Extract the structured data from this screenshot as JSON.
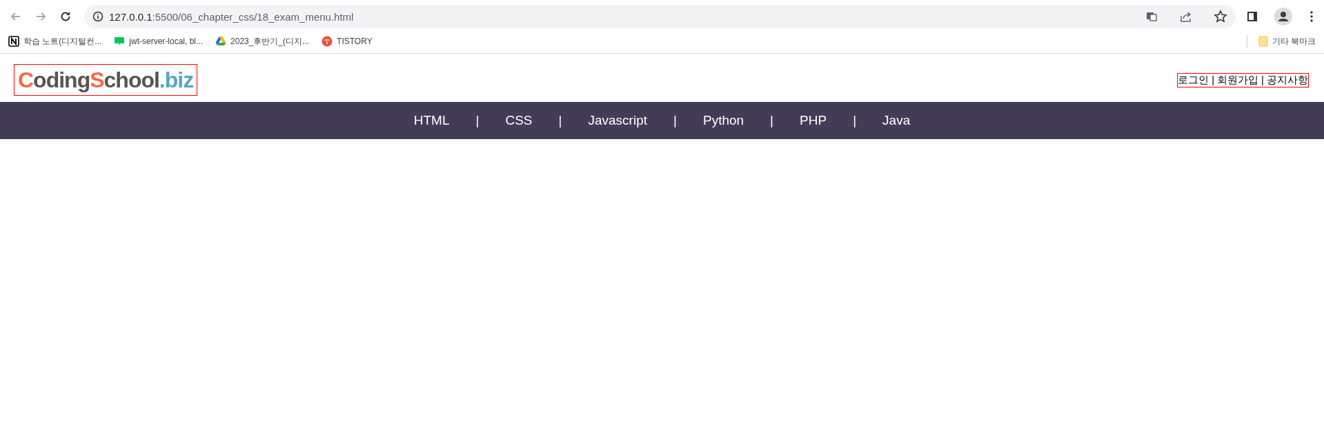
{
  "browser": {
    "url_host": "127.0.0.1",
    "url_path": ":5500/06_chapter_css/18_exam_menu.html",
    "bookmarks": [
      {
        "kind": "notion",
        "label": "학습 노트(디지털컨..."
      },
      {
        "kind": "blog",
        "label": "jwt-server-local, bl..."
      },
      {
        "kind": "drive",
        "label": "2023_후반기_(디지..."
      },
      {
        "kind": "tistory",
        "label": "TISTORY"
      }
    ],
    "other_bookmarks": "기타 북마크"
  },
  "logo": {
    "parts": [
      {
        "text": "C",
        "color": "#f26b43"
      },
      {
        "text": "oding",
        "color": "#555555"
      },
      {
        "text": "S",
        "color": "#f26b43"
      },
      {
        "text": "chool",
        "color": "#555555"
      },
      {
        "text": ".biz",
        "color": "#5aa5c3"
      }
    ]
  },
  "top_links": [
    {
      "text": "로그인",
      "separator": "|"
    },
    {
      "text": "회원가입",
      "separator": "|"
    },
    {
      "text": "공지사항"
    }
  ],
  "nav": [
    {
      "text": "HTML",
      "separator": "|"
    },
    {
      "text": "CSS",
      "separator": "|"
    },
    {
      "text": "Javascript",
      "separator": "|"
    },
    {
      "text": "Python",
      "separator": "|"
    },
    {
      "text": "PHP",
      "separator": "|"
    },
    {
      "text": "Java"
    }
  ]
}
